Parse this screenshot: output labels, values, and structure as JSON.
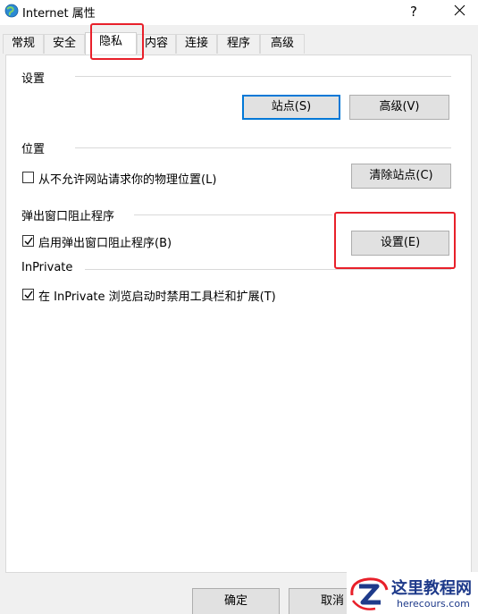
{
  "window": {
    "title": "Internet 属性",
    "help_label": "?"
  },
  "tabs": [
    {
      "label": "常规"
    },
    {
      "label": "安全"
    },
    {
      "label": "隐私",
      "active": true
    },
    {
      "label": "内容"
    },
    {
      "label": "连接"
    },
    {
      "label": "程序"
    },
    {
      "label": "高级"
    }
  ],
  "settings": {
    "heading": "设置",
    "sites_label": "站点(S)",
    "advanced_label": "高级(V)"
  },
  "location": {
    "heading": "位置",
    "never_allow_label": "从不允许网站请求你的物理位置(L)",
    "never_allow_checked": false,
    "clear_sites_label": "清除站点(C)"
  },
  "popup": {
    "heading": "弹出窗口阻止程序",
    "enable_label": "启用弹出窗口阻止程序(B)",
    "enable_checked": true,
    "settings_label": "设置(E)"
  },
  "inprivate": {
    "heading": "InPrivate",
    "disable_toolbars_label": "在 InPrivate 浏览启动时禁用工具栏和扩展(T)",
    "disable_toolbars_checked": true
  },
  "footer": {
    "ok_label": "确定",
    "cancel_label": "取消"
  },
  "watermark": {
    "text": "这里教程网",
    "url": "herecours.com"
  },
  "colors": {
    "highlight": "#e8202a",
    "accent": "#0078d7"
  }
}
